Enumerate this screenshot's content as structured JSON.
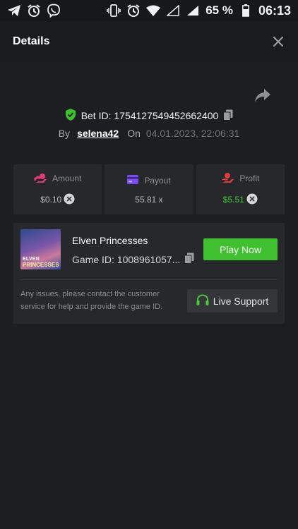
{
  "status_bar": {
    "left_icons": [
      "telegram-icon",
      "alarm-icon",
      "viber-icon"
    ],
    "right_icons": [
      "vibrate-icon",
      "alarm-icon",
      "wifi-icon",
      "signal-empty-icon",
      "signal-icon",
      "battery-icon"
    ],
    "battery_percent": "65 %",
    "time": "06:13"
  },
  "header": {
    "title": "Details"
  },
  "bet": {
    "bet_id": "Bet ID: 1754127549452662400",
    "by_label": "By",
    "username": "selena42",
    "on_label": "On",
    "date": "04.01.2023, 22:06:31"
  },
  "stats": [
    {
      "label": "Amount",
      "value": "$0.10",
      "icon": "amount-icon",
      "has_currency_badge": true
    },
    {
      "label": "Payout",
      "value": "55.81 x",
      "icon": "payout-card-icon",
      "has_currency_badge": false
    },
    {
      "label": "Profit",
      "value": "$5.51",
      "icon": "profit-icon",
      "has_currency_badge": true
    }
  ],
  "game": {
    "name": "Elven Princesses",
    "thumb_text_1": "ELVEN",
    "thumb_text_2": "PRINCESSES",
    "game_id": "Game ID: 1008961057...",
    "play_label": "Play Now",
    "support_text": "Any issues, please contact the customer service for help and provide the game ID.",
    "support_label": "Live Support"
  },
  "colors": {
    "background": "#1d1e21",
    "card": "#27282b",
    "accent_green": "#3fc12f",
    "amount_icon": "#e23b74",
    "payout_icon": "#7b4df0",
    "profit_icon": "#e23b3b"
  }
}
